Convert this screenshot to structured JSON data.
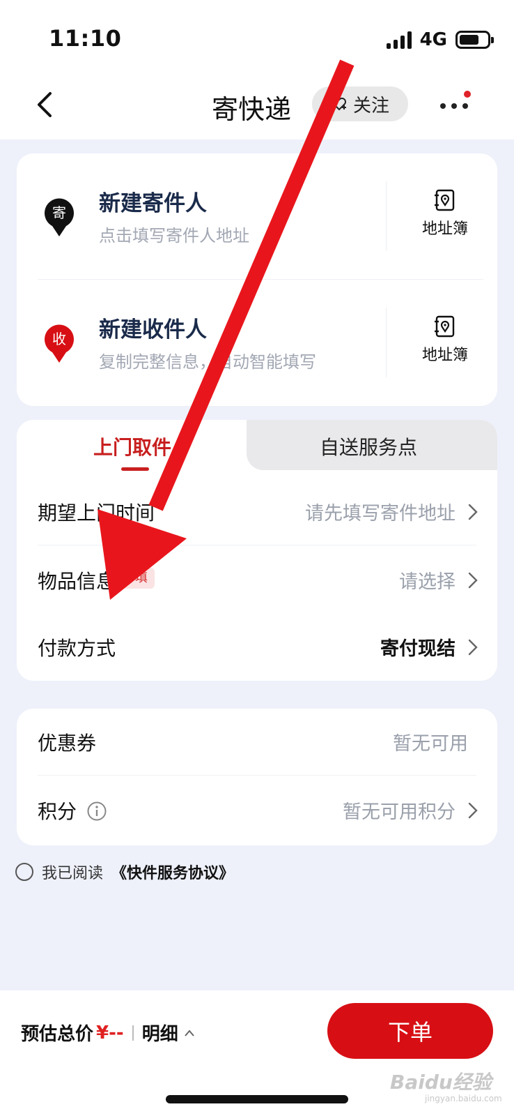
{
  "status_bar": {
    "time": "11:10",
    "network": "4G",
    "battery_level": 0.7
  },
  "nav": {
    "title": "寄快递",
    "follow_label": "关注"
  },
  "sender": {
    "title": "新建寄件人",
    "subtitle": "点击填写寄件人地址",
    "pin_char": "寄",
    "book_label": "地址簿"
  },
  "receiver": {
    "title": "新建收件人",
    "subtitle": "复制完整信息，自动智能填写",
    "pin_char": "收",
    "book_label": "地址簿"
  },
  "tabs": {
    "active": "上门取件",
    "inactive": "自送服务点"
  },
  "rows": {
    "pickup_time": {
      "label": "期望上门时间",
      "value": "请先填写寄件地址"
    },
    "item_info": {
      "label": "物品信息",
      "badge": "必填",
      "value": "请选择"
    },
    "payment": {
      "label": "付款方式",
      "value": "寄付现结"
    }
  },
  "coupon": {
    "label": "优惠券",
    "value": "暂无可用"
  },
  "points": {
    "label": "积分",
    "value": "暂无可用积分"
  },
  "agreement": {
    "prefix": "我已阅读",
    "link": "《快件服务协议》"
  },
  "bottom": {
    "total_label": "预估总价",
    "price": "¥--",
    "detail_label": "明细",
    "order_label": "下单"
  },
  "watermark": {
    "brand": "Baidu经验",
    "url": "jingyan.baidu.com"
  },
  "colors": {
    "accent": "#d70f14",
    "arrow": "#e8161c",
    "page_bg": "#eef1fa"
  }
}
